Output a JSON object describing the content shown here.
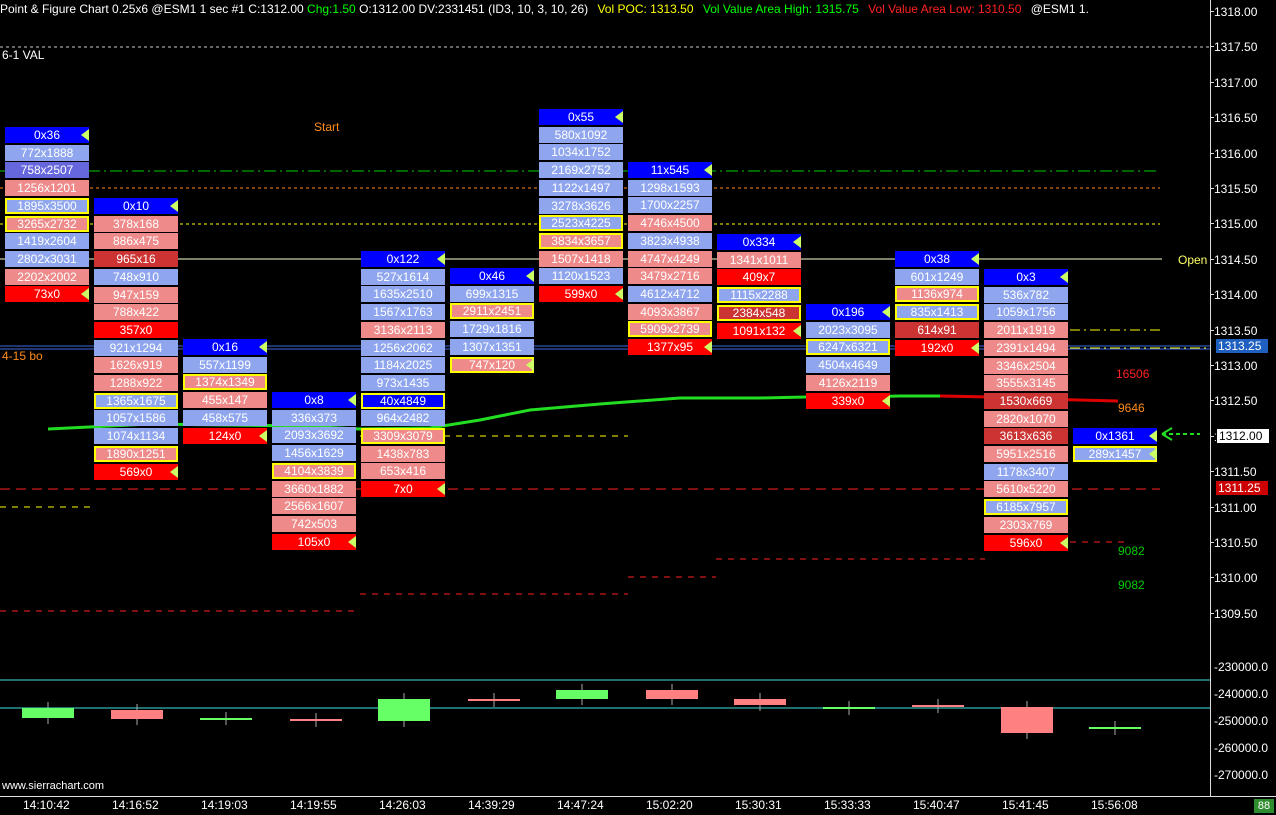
{
  "header": {
    "title": "Point & Figure Chart 0.25x6 @ESM1  1 sec   #1 C:1312.00",
    "chg": "Chg:1.50",
    "info": "O:1312.00 DV:2331451  (ID3, 10, 3, 10, 26)",
    "poc": "Vol POC: 1313.50",
    "vah": "Vol Value Area High: 1315.75",
    "val": "Vol Value Area Low: 1310.50",
    "sym": "@ESM1  1."
  },
  "colors": {
    "up": "#0000ff",
    "down": "#ff0000",
    "bidheavy": "#ff9999",
    "askheavy": "#9999ff",
    "poc": "#00ff00",
    "vah": "#ffff00",
    "val": "#ff0000"
  },
  "labels": {
    "val_61": "6-1 VAL",
    "start": "Start",
    "open": "Open",
    "bo_415": "4-15 bo",
    "n16506": "16506",
    "n9646": "9646",
    "n9082a": "9082",
    "n9082b": "9082",
    "watermark": "www.sierrachart.com",
    "status": "88"
  },
  "price_axis": [
    "1318.00",
    "1317.50",
    "1317.00",
    "1316.50",
    "1316.00",
    "1315.50",
    "1315.00",
    "1314.50",
    "1314.00",
    "1313.50",
    "1313.00",
    "1312.50",
    "1312.00",
    "1311.50",
    "1311.00",
    "1310.50",
    "1310.00",
    "1309.50"
  ],
  "price_tags": {
    "blue": "1313.25",
    "current": "1312.00",
    "red": "1311.25"
  },
  "cvd_axis": [
    "-230000.0",
    "-240000.0",
    "-250000.0",
    "-260000.0",
    "-270000.0"
  ],
  "time_axis": [
    "14:10:42",
    "14:16:52",
    "14:19:03",
    "14:19:55",
    "14:26:03",
    "14:39:29",
    "14:47:24",
    "15:02:20",
    "15:30:31",
    "15:33:33",
    "15:40:47",
    "15:41:45",
    "15:56:08"
  ],
  "columns": [
    {
      "cells": [
        {
          "t": "0x36",
          "c": "up"
        },
        {
          "t": "772x1888",
          "c": "ask"
        },
        {
          "t": "758x2507",
          "c": "askd"
        },
        {
          "t": "1256x1201",
          "c": "bid"
        },
        {
          "t": "1895x3500",
          "c": "ask",
          "o": "y"
        },
        {
          "t": "3265x2732",
          "c": "bid",
          "o": "y"
        },
        {
          "t": "1419x2604",
          "c": "ask"
        },
        {
          "t": "2802x3031",
          "c": "ask"
        },
        {
          "t": "2202x2002",
          "c": "bid"
        },
        {
          "t": "73x0",
          "c": "down"
        }
      ]
    },
    {
      "cells": [
        {
          "t": "0x10",
          "c": "up"
        },
        {
          "t": "378x168",
          "c": "bid"
        },
        {
          "t": "886x475",
          "c": "bid"
        },
        {
          "t": "965x16",
          "c": "bidd"
        },
        {
          "t": "748x910",
          "c": "ask"
        },
        {
          "t": "947x159",
          "c": "bid"
        },
        {
          "t": "788x422",
          "c": "bid"
        },
        {
          "t": "357x0",
          "c": "down"
        },
        {
          "t": "921x1294",
          "c": "ask"
        },
        {
          "t": "1626x919",
          "c": "bid"
        },
        {
          "t": "1288x922",
          "c": "bid"
        },
        {
          "t": "1365x1675",
          "c": "ask",
          "o": "y"
        },
        {
          "t": "1057x1586",
          "c": "ask"
        },
        {
          "t": "1074x1134",
          "c": "ask"
        },
        {
          "t": "1890x1251",
          "c": "bid",
          "o": "y"
        },
        {
          "t": "569x0",
          "c": "down"
        }
      ]
    },
    {
      "cells": [
        {
          "t": "0x16",
          "c": "up"
        },
        {
          "t": "557x1199",
          "c": "ask"
        },
        {
          "t": "1374x1349",
          "c": "bid",
          "o": "y"
        },
        {
          "t": "455x147",
          "c": "bid"
        },
        {
          "t": "458x575",
          "c": "ask"
        },
        {
          "t": "124x0",
          "c": "down"
        }
      ]
    },
    {
      "cells": [
        {
          "t": "0x8",
          "c": "up"
        },
        {
          "t": "336x373",
          "c": "ask"
        },
        {
          "t": "2093x3692",
          "c": "ask"
        },
        {
          "t": "1456x1629",
          "c": "ask"
        },
        {
          "t": "4104x3839",
          "c": "bid",
          "o": "y"
        },
        {
          "t": "3660x1882",
          "c": "bid"
        },
        {
          "t": "2566x1607",
          "c": "bid"
        },
        {
          "t": "742x503",
          "c": "bid"
        },
        {
          "t": "105x0",
          "c": "down"
        }
      ]
    },
    {
      "cells": [
        {
          "t": "0x122",
          "c": "up"
        },
        {
          "t": "527x1614",
          "c": "ask"
        },
        {
          "t": "1635x2510",
          "c": "ask"
        },
        {
          "t": "1567x1763",
          "c": "ask"
        },
        {
          "t": "3136x2113",
          "c": "bid"
        },
        {
          "t": "1256x2062",
          "c": "ask"
        },
        {
          "t": "1184x2025",
          "c": "ask"
        },
        {
          "t": "973x1435",
          "c": "ask"
        },
        {
          "t": "40x4849",
          "c": "up",
          "o": "y"
        },
        {
          "t": "964x2482",
          "c": "ask"
        },
        {
          "t": "3309x3079",
          "c": "bid",
          "o": "y"
        },
        {
          "t": "1438x783",
          "c": "bid"
        },
        {
          "t": "653x416",
          "c": "bid"
        },
        {
          "t": "7x0",
          "c": "down"
        }
      ]
    },
    {
      "cells": [
        {
          "t": "0x46",
          "c": "up"
        },
        {
          "t": "699x1315",
          "c": "ask"
        },
        {
          "t": "2911x2451",
          "c": "bid",
          "o": "y"
        },
        {
          "t": "1729x1816",
          "c": "ask"
        },
        {
          "t": "1307x1351",
          "c": "ask"
        },
        {
          "t": "747x120",
          "c": "bid",
          "o": "y"
        }
      ]
    },
    {
      "cells": [
        {
          "t": "0x55",
          "c": "up"
        },
        {
          "t": "580x1092",
          "c": "ask"
        },
        {
          "t": "1034x1752",
          "c": "ask"
        },
        {
          "t": "2169x2752",
          "c": "ask"
        },
        {
          "t": "1122x1497",
          "c": "ask"
        },
        {
          "t": "3278x3626",
          "c": "ask"
        },
        {
          "t": "2523x4225",
          "c": "ask",
          "o": "y"
        },
        {
          "t": "3834x3657",
          "c": "bid",
          "o": "y"
        },
        {
          "t": "1507x1418",
          "c": "bid"
        },
        {
          "t": "1120x1523",
          "c": "ask"
        },
        {
          "t": "599x0",
          "c": "down"
        }
      ]
    },
    {
      "cells": [
        {
          "t": "11x545",
          "c": "up"
        },
        {
          "t": "1298x1593",
          "c": "ask"
        },
        {
          "t": "1700x2257",
          "c": "ask"
        },
        {
          "t": "4746x4500",
          "c": "bid"
        },
        {
          "t": "3823x4938",
          "c": "ask"
        },
        {
          "t": "4747x4249",
          "c": "bid"
        },
        {
          "t": "3479x2716",
          "c": "bid"
        },
        {
          "t": "4612x4712",
          "c": "ask"
        },
        {
          "t": "4093x3867",
          "c": "bid"
        },
        {
          "t": "5909x2739",
          "c": "bid",
          "o": "y"
        },
        {
          "t": "1377x95",
          "c": "down"
        }
      ]
    },
    {
      "cells": [
        {
          "t": "0x334",
          "c": "up"
        },
        {
          "t": "1341x1011",
          "c": "bid"
        },
        {
          "t": "409x7",
          "c": "down"
        },
        {
          "t": "1115x2288",
          "c": "ask",
          "o": "y"
        },
        {
          "t": "2384x548",
          "c": "bidd",
          "o": "y"
        },
        {
          "t": "1091x132",
          "c": "down"
        }
      ]
    },
    {
      "cells": [
        {
          "t": "0x196",
          "c": "up"
        },
        {
          "t": "2023x3095",
          "c": "ask"
        },
        {
          "t": "6247x6321",
          "c": "ask",
          "o": "y"
        },
        {
          "t": "4504x4649",
          "c": "ask"
        },
        {
          "t": "4126x2119",
          "c": "bid"
        },
        {
          "t": "339x0",
          "c": "down"
        }
      ]
    },
    {
      "cells": [
        {
          "t": "0x38",
          "c": "up"
        },
        {
          "t": "601x1249",
          "c": "ask"
        },
        {
          "t": "1136x974",
          "c": "bid",
          "o": "y"
        },
        {
          "t": "835x1413",
          "c": "ask",
          "o": "y"
        },
        {
          "t": "614x91",
          "c": "bidd"
        },
        {
          "t": "192x0",
          "c": "down"
        }
      ]
    },
    {
      "cells": [
        {
          "t": "0x3",
          "c": "up"
        },
        {
          "t": "536x782",
          "c": "ask"
        },
        {
          "t": "1059x1756",
          "c": "ask"
        },
        {
          "t": "2011x1919",
          "c": "bid"
        },
        {
          "t": "2391x1494",
          "c": "bid"
        },
        {
          "t": "3346x2504",
          "c": "bid"
        },
        {
          "t": "3555x3145",
          "c": "bid"
        },
        {
          "t": "1530x669",
          "c": "bidd"
        },
        {
          "t": "2820x1070",
          "c": "bid"
        },
        {
          "t": "3613x636",
          "c": "bidd"
        },
        {
          "t": "5951x2516",
          "c": "bid"
        },
        {
          "t": "1178x3407",
          "c": "ask"
        },
        {
          "t": "5610x5220",
          "c": "bid"
        },
        {
          "t": "6185x7957",
          "c": "ask",
          "o": "y"
        },
        {
          "t": "2303x769",
          "c": "bid"
        },
        {
          "t": "596x0",
          "c": "down"
        }
      ]
    },
    {
      "cells": [
        {
          "t": "0x1361",
          "c": "up"
        },
        {
          "t": "289x1457",
          "c": "ask",
          "o": "y"
        }
      ]
    }
  ]
}
